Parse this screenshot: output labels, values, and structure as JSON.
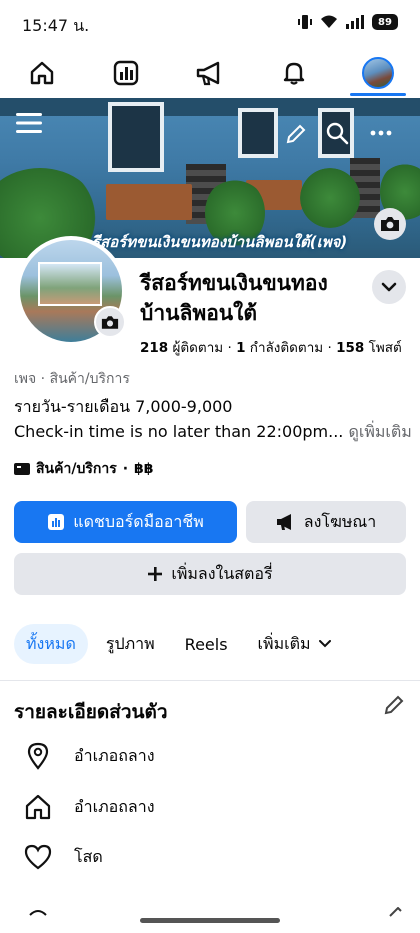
{
  "status_bar": {
    "time": "15:47 น.",
    "battery": "89"
  },
  "nav": {
    "tabs": [
      {
        "icon": "home-icon",
        "active": false
      },
      {
        "icon": "dashboard-icon",
        "active": false
      },
      {
        "icon": "megaphone-icon",
        "active": false
      },
      {
        "icon": "bell-icon",
        "active": false
      },
      {
        "icon": "profile-avatar",
        "active": true
      }
    ]
  },
  "cover": {
    "title": "รีสอร์ทขนเงินขนทองบ้านลิพอนใต้(เพจ)"
  },
  "profile": {
    "name": "รีสอร์ทขนเงินขนทอง บ้านลิพอนใต้",
    "followers_count": "218",
    "followers_label": "ผู้ติดตาม",
    "following_count": "1",
    "following_label": "กำลังติดตาม",
    "posts_count": "158",
    "posts_label": "โพสต์",
    "category": "เพจ · สินค้า/บริการ",
    "description_line1": "รายวัน-รายเดือน 7,000-9,000",
    "description_line2": "Check-in time is no later than 22:00pm...",
    "see_more": "ดูเพิ่มเติม",
    "services_label": "สินค้า/บริการ",
    "services_price": "฿฿"
  },
  "actions": {
    "dashboard": "แดชบอร์ดมืออาชีพ",
    "advertise": "ลงโฆษณา",
    "add_story": "เพิ่มลงในสตอรี่"
  },
  "tabs": {
    "all": "ทั้งหมด",
    "photos": "รูปภาพ",
    "reels": "Reels",
    "more": "เพิ่มเติม"
  },
  "details": {
    "title": "รายละเอียดส่วนตัว",
    "items": [
      {
        "icon": "location-pin-icon",
        "text": "อำเภอถลาง"
      },
      {
        "icon": "home-icon",
        "text": "อำเภอถลาง"
      },
      {
        "icon": "heart-icon",
        "text": "โสด"
      }
    ]
  },
  "colors": {
    "primary": "#1877f2",
    "secondary_bg": "#e4e6eb",
    "text": "#050505",
    "muted": "#65676b"
  }
}
